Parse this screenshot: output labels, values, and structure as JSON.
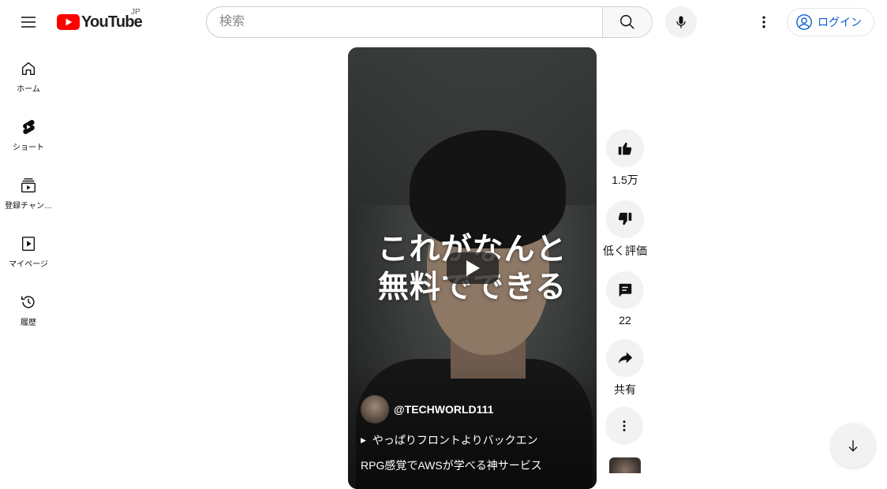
{
  "header": {
    "logo_text": "YouTube",
    "region": "JP",
    "search_placeholder": "検索",
    "login_label": "ログイン"
  },
  "sidebar": {
    "items": [
      {
        "label": "ホーム",
        "icon": "home-icon"
      },
      {
        "label": "ショート",
        "icon": "shorts-icon"
      },
      {
        "label": "登録チャン…",
        "icon": "subscriptions-icon"
      },
      {
        "label": "マイページ",
        "icon": "library-icon"
      },
      {
        "label": "履歴",
        "icon": "history-icon"
      }
    ]
  },
  "short": {
    "overlay_line1": "これがなんと",
    "overlay_line2": "無料でできる",
    "channel": "@TECHWORLD111",
    "music": "やっぱりフロントよりバックエン",
    "caption": "RPG感覚でAWSが学べる神サービス"
  },
  "actions": {
    "like_count": "1.5万",
    "dislike_label": "低く評価",
    "comment_count": "22",
    "share_label": "共有"
  },
  "colors": {
    "brand_red": "#ff0000",
    "link_blue": "#065fd4",
    "button_bg": "#f2f2f2"
  }
}
